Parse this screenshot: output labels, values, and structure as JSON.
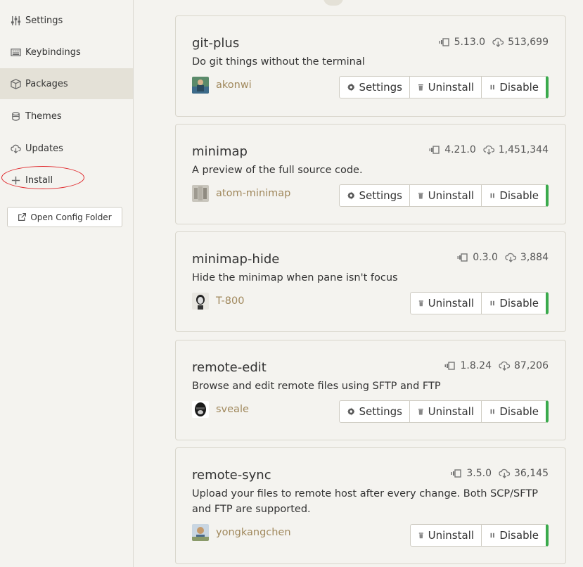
{
  "sidebar": {
    "items": [
      {
        "label": "Settings",
        "icon": "settings-sliders-icon"
      },
      {
        "label": "Keybindings",
        "icon": "keyboard-icon"
      },
      {
        "label": "Packages",
        "icon": "package-icon"
      },
      {
        "label": "Themes",
        "icon": "paintcan-icon"
      },
      {
        "label": "Updates",
        "icon": "cloud-download-icon"
      },
      {
        "label": "Install",
        "icon": "plus-icon"
      }
    ],
    "open_config_label": "Open Config Folder"
  },
  "packages": [
    {
      "name": "git-plus",
      "description": "Do git things without the terminal",
      "version": "5.13.0",
      "downloads": "513,699",
      "author": "akonwi",
      "buttons": {
        "settings": "Settings",
        "uninstall": "Uninstall",
        "disable": "Disable"
      }
    },
    {
      "name": "minimap",
      "description": "A preview of the full source code.",
      "version": "4.21.0",
      "downloads": "1,451,344",
      "author": "atom-minimap",
      "buttons": {
        "settings": "Settings",
        "uninstall": "Uninstall",
        "disable": "Disable"
      }
    },
    {
      "name": "minimap-hide",
      "description": "Hide the minimap when pane isn't focus",
      "version": "0.3.0",
      "downloads": "3,884",
      "author": "T-800",
      "buttons": {
        "uninstall": "Uninstall",
        "disable": "Disable"
      }
    },
    {
      "name": "remote-edit",
      "description": "Browse and edit remote files using SFTP and FTP",
      "version": "1.8.24",
      "downloads": "87,206",
      "author": "sveale",
      "buttons": {
        "settings": "Settings",
        "uninstall": "Uninstall",
        "disable": "Disable"
      }
    },
    {
      "name": "remote-sync",
      "description": "Upload your files to remote host after every change. Both SCP/SFTP and FTP are supported.",
      "version": "3.5.0",
      "downloads": "36,145",
      "author": "yongkangchen",
      "buttons": {
        "uninstall": "Uninstall",
        "disable": "Disable"
      }
    }
  ],
  "colors": {
    "accent_enabled": "#3aaa4c",
    "author_link": "#a0885c",
    "annotation": "#e0262a"
  }
}
